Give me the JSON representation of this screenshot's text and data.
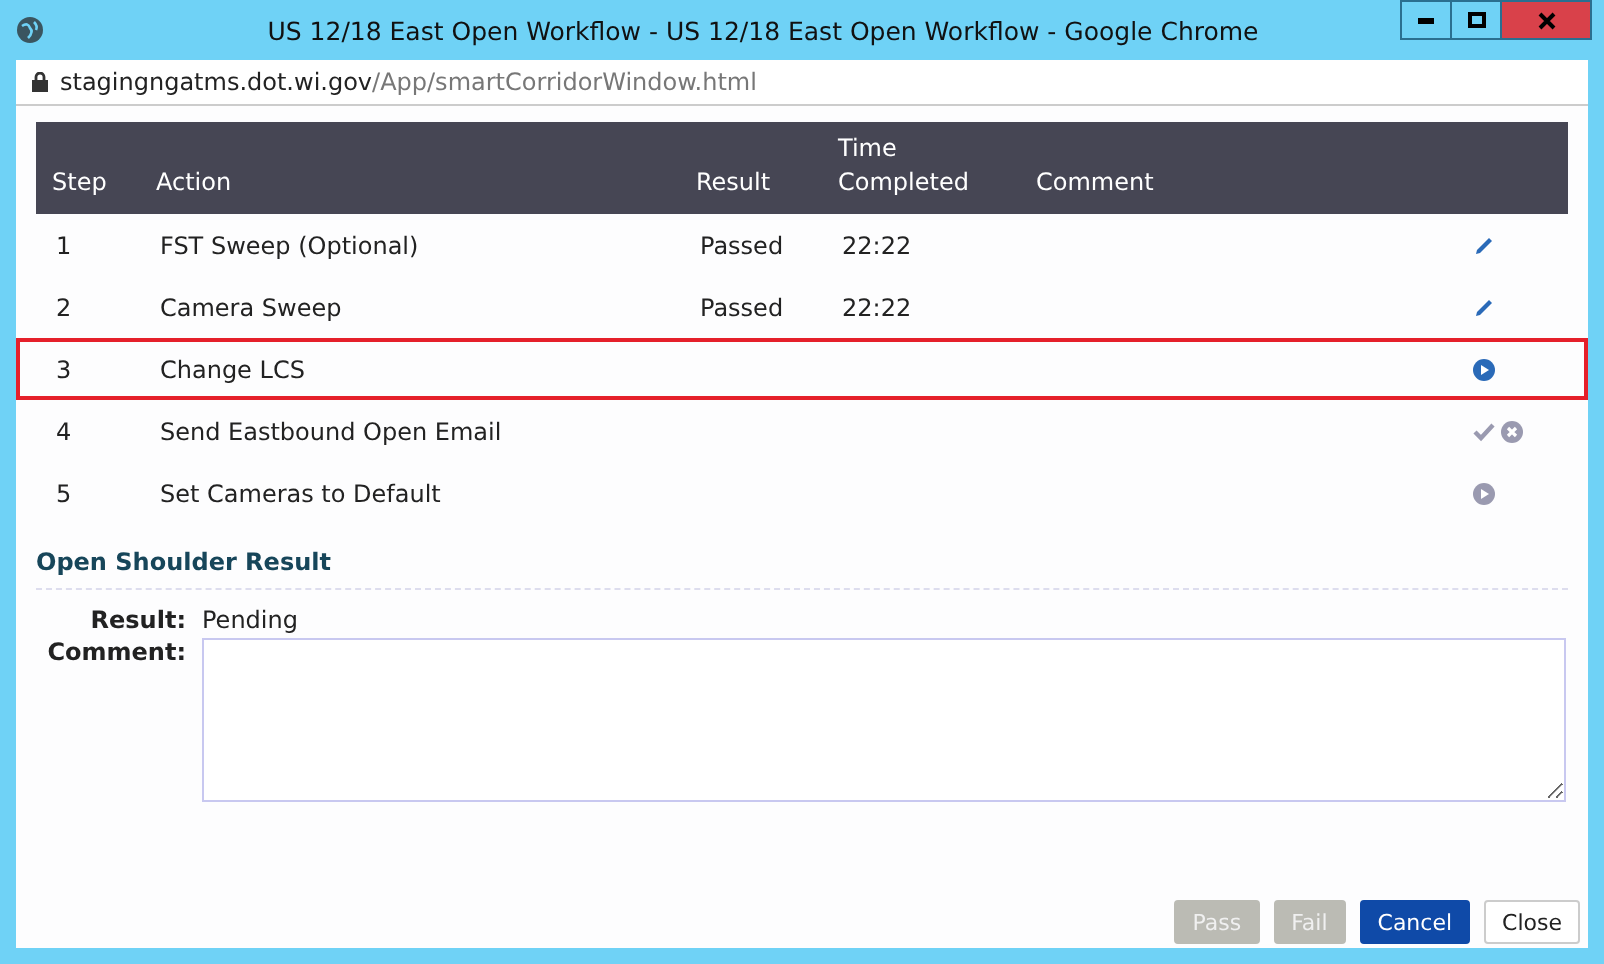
{
  "window": {
    "title": "US 12/18 East Open Workflow - US 12/18 East Open Workflow - Google Chrome",
    "url_host": "stagingngatms.dot.wi.gov",
    "url_path": "/App/smartCorridorWindow.html"
  },
  "table": {
    "columns": [
      "Step",
      "Action",
      "Result",
      "Time Completed",
      "Comment"
    ],
    "rows": [
      {
        "step": "1",
        "action": "FST Sweep (Optional)",
        "result": "Passed",
        "time": "22:22",
        "selected": false,
        "controls": [
          {
            "kind": "edit",
            "disabled": false
          }
        ]
      },
      {
        "step": "2",
        "action": "Camera Sweep",
        "result": "Passed",
        "time": "22:22",
        "selected": false,
        "controls": [
          {
            "kind": "edit",
            "disabled": false
          }
        ]
      },
      {
        "step": "3",
        "action": "Change LCS",
        "selected": true,
        "controls": [
          {
            "kind": "run",
            "disabled": false
          }
        ]
      },
      {
        "step": "4",
        "action": "Send Eastbound Open Email",
        "selected": false,
        "controls": [
          {
            "kind": "pass",
            "disabled": true
          },
          {
            "kind": "fail",
            "disabled": true
          }
        ]
      },
      {
        "step": "5",
        "action": "Set Cameras to Default",
        "selected": false,
        "controls": [
          {
            "kind": "run",
            "disabled": true
          }
        ]
      }
    ]
  },
  "result_section": {
    "title": "Open Shoulder Result",
    "result_label": "Result:",
    "result_value": "Pending",
    "comment_label": "Comment:"
  },
  "buttons": [
    {
      "label": "Pass",
      "kind": "plain",
      "disabled": true
    },
    {
      "label": "Fail",
      "kind": "plain",
      "disabled": true
    },
    {
      "label": "Cancel",
      "kind": "primary",
      "disabled": false
    },
    {
      "label": "Close",
      "kind": "default",
      "disabled": false
    }
  ]
}
